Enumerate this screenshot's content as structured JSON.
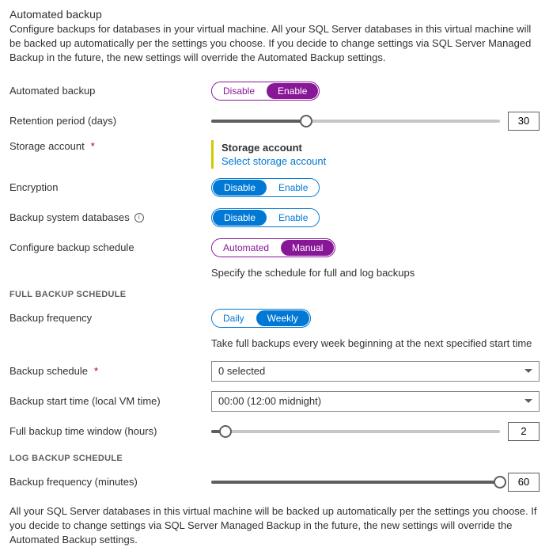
{
  "page_title": "Automated backup",
  "description": "Configure backups for databases in your virtual machine. All your SQL Server databases in this virtual machine will be backed up automatically per the settings you choose. If you decide to change settings via SQL Server Managed Backup in the future, the new settings will override the Automated Backup settings.",
  "labels": {
    "automated_backup": "Automated backup",
    "retention": "Retention period (days)",
    "storage_account": "Storage account",
    "encryption": "Encryption",
    "system_db": "Backup system databases",
    "schedule": "Configure backup schedule",
    "frequency": "Backup frequency",
    "bk_schedule": "Backup schedule",
    "start_time": "Backup start time (local VM time)",
    "full_window": "Full backup time window (hours)",
    "log_freq": "Backup frequency (minutes)"
  },
  "toggle": {
    "disable": "Disable",
    "enable": "Enable",
    "automated": "Automated",
    "manual": "Manual",
    "daily": "Daily",
    "weekly": "Weekly"
  },
  "values": {
    "retention": "30",
    "full_window": "2",
    "log_freq": "60",
    "schedule_select": "0 selected",
    "start_time": "00:00 (12:00 midnight)"
  },
  "storage": {
    "title": "Storage account",
    "link": "Select storage account"
  },
  "helper_schedule": "Specify the schedule for full and log backups",
  "helper_frequency": "Take full backups every week beginning at the next specified start time",
  "section_full": "FULL BACKUP SCHEDULE",
  "section_log": "LOG BACKUP SCHEDULE",
  "footer": "All your SQL Server databases in this virtual machine will be backed up automatically per the settings you choose. If you decide to change settings via SQL Server Managed Backup in the future, the new settings will override the Automated Backup settings."
}
